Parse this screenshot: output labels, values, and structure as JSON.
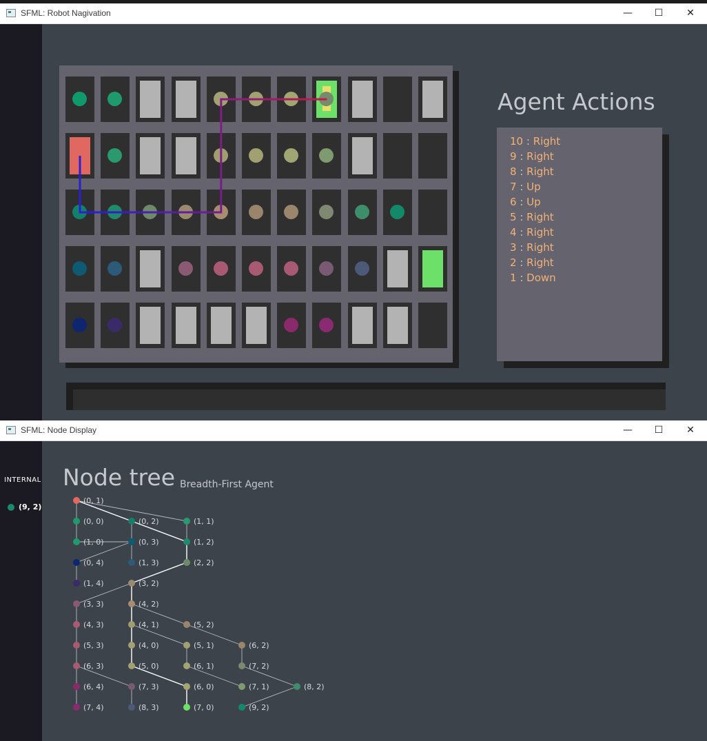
{
  "window1": {
    "title": "SFML: Robot Nagivation",
    "controls": {
      "minimize": "—",
      "maximize": "☐",
      "close": "✕"
    }
  },
  "window2": {
    "title": "SFML: Node Display",
    "controls": {
      "minimize": "—",
      "maximize": "☐",
      "close": "✕"
    }
  },
  "grid": {
    "cols": 11,
    "rows": 5,
    "cells": [
      [
        "#0f9a6b",
        "#1f9a6c",
        "wall",
        "wall",
        "#a3a074",
        "#a0a070",
        "#a2a671",
        "goal-current",
        "wall",
        "empty",
        "wall"
      ],
      [
        "start",
        "#2a9a6e",
        "wall",
        "wall",
        "#a09d70",
        "#a0a070",
        "#9fa672",
        "#7e9a6e",
        "wall",
        "empty",
        "empty"
      ],
      [
        "#15806a",
        "#1f8a6c",
        "#6f8a6a",
        "#9a8a6e",
        "#a88c70",
        "#9a846c",
        "#9a866c",
        "#7f8870",
        "#3e8e6c",
        "#128a6a",
        "empty"
      ],
      [
        "#0d5a72",
        "#2e5a7a",
        "wall",
        "#8a5a72",
        "#a85a72",
        "#a85a72",
        "#a85a74",
        "#7a5a72",
        "#4c5a7a",
        "wall",
        "goal"
      ],
      [
        "#0e2670",
        "#3a2a6a",
        "wall",
        "wall",
        "wall",
        "wall",
        "#8a2a6a",
        "#8a2a72",
        "wall",
        "wall",
        "empty"
      ]
    ],
    "colors": {
      "start": "#e06860",
      "goal": "#6de06a",
      "current_marker": "#e8e06a",
      "current_dot": "#788a6c",
      "path_start": "#2a1fd0",
      "path_end": "#c21a4a"
    },
    "path_cells": [
      [
        0,
        1
      ],
      [
        0,
        2
      ],
      [
        1,
        2
      ],
      [
        2,
        2
      ],
      [
        3,
        2
      ],
      [
        4,
        2
      ],
      [
        4,
        1
      ],
      [
        4,
        0
      ],
      [
        5,
        0
      ],
      [
        6,
        0
      ],
      [
        7,
        0
      ]
    ]
  },
  "actions": {
    "title": "Agent Actions",
    "items": [
      {
        "num": "10",
        "dir": "Right"
      },
      {
        "num": "9",
        "dir": "Right"
      },
      {
        "num": "8",
        "dir": "Right"
      },
      {
        "num": "7",
        "dir": "Up"
      },
      {
        "num": "6",
        "dir": "Up"
      },
      {
        "num": "5",
        "dir": "Right"
      },
      {
        "num": "4",
        "dir": "Right"
      },
      {
        "num": "3",
        "dir": "Right"
      },
      {
        "num": "2",
        "dir": "Right"
      },
      {
        "num": "1",
        "dir": "Down"
      }
    ]
  },
  "node_display": {
    "internal_label": "INTERNAL",
    "internal_node": "(9, 2)",
    "internal_color": "#1b8a6b",
    "tree_title": "Node tree",
    "tree_subtitle": "Breadth-First Agent",
    "nodes": [
      {
        "id": "0,1",
        "label": "(0, 1)",
        "color": "#e06860",
        "col": 0,
        "row": 0
      },
      {
        "id": "0,0",
        "label": "(0, 0)",
        "color": "#1f9a6c",
        "col": 0,
        "row": 1
      },
      {
        "id": "0,2",
        "label": "(0, 2)",
        "color": "#15806a",
        "col": 1,
        "row": 1
      },
      {
        "id": "1,1",
        "label": "(1, 1)",
        "color": "#2a9a6e",
        "col": 2,
        "row": 1
      },
      {
        "id": "1,0",
        "label": "(1, 0)",
        "color": "#1f9a6c",
        "col": 0,
        "row": 2
      },
      {
        "id": "0,3",
        "label": "(0, 3)",
        "color": "#0d5a72",
        "col": 1,
        "row": 2
      },
      {
        "id": "1,2",
        "label": "(1, 2)",
        "color": "#1f8a6c",
        "col": 2,
        "row": 2
      },
      {
        "id": "0,4",
        "label": "(0, 4)",
        "color": "#0e2670",
        "col": 0,
        "row": 3
      },
      {
        "id": "1,3",
        "label": "(1, 3)",
        "color": "#2e5a7a",
        "col": 1,
        "row": 3
      },
      {
        "id": "2,2",
        "label": "(2, 2)",
        "color": "#6f8a6a",
        "col": 2,
        "row": 3
      },
      {
        "id": "1,4",
        "label": "(1, 4)",
        "color": "#3a2a6a",
        "col": 0,
        "row": 4
      },
      {
        "id": "3,2",
        "label": "(3, 2)",
        "color": "#9a8a6e",
        "col": 1,
        "row": 4
      },
      {
        "id": "3,3",
        "label": "(3, 3)",
        "color": "#8a5a72",
        "col": 0,
        "row": 5
      },
      {
        "id": "4,2",
        "label": "(4, 2)",
        "color": "#a88c70",
        "col": 1,
        "row": 5
      },
      {
        "id": "4,3",
        "label": "(4, 3)",
        "color": "#a85a72",
        "col": 0,
        "row": 6
      },
      {
        "id": "4,1",
        "label": "(4, 1)",
        "color": "#a09d70",
        "col": 1,
        "row": 6
      },
      {
        "id": "5,2",
        "label": "(5, 2)",
        "color": "#9a846c",
        "col": 2,
        "row": 6
      },
      {
        "id": "5,3",
        "label": "(5, 3)",
        "color": "#a85a72",
        "col": 0,
        "row": 7
      },
      {
        "id": "4,0",
        "label": "(4, 0)",
        "color": "#a3a074",
        "col": 1,
        "row": 7
      },
      {
        "id": "5,1",
        "label": "(5, 1)",
        "color": "#a0a070",
        "col": 2,
        "row": 7
      },
      {
        "id": "6,2",
        "label": "(6, 2)",
        "color": "#9a866c",
        "col": 3,
        "row": 7
      },
      {
        "id": "6,3",
        "label": "(6, 3)",
        "color": "#a85a74",
        "col": 0,
        "row": 8
      },
      {
        "id": "5,0",
        "label": "(5, 0)",
        "color": "#a0a070",
        "col": 1,
        "row": 8
      },
      {
        "id": "6,1",
        "label": "(6, 1)",
        "color": "#9fa672",
        "col": 2,
        "row": 8
      },
      {
        "id": "7,2",
        "label": "(7, 2)",
        "color": "#7f8870",
        "col": 3,
        "row": 8
      },
      {
        "id": "6,4",
        "label": "(6, 4)",
        "color": "#8a2a6a",
        "col": 0,
        "row": 9
      },
      {
        "id": "7,3",
        "label": "(7, 3)",
        "color": "#7a5a72",
        "col": 1,
        "row": 9
      },
      {
        "id": "6,0",
        "label": "(6, 0)",
        "color": "#a2a671",
        "col": 2,
        "row": 9
      },
      {
        "id": "7,1",
        "label": "(7, 1)",
        "color": "#7e9a6e",
        "col": 3,
        "row": 9
      },
      {
        "id": "8,2",
        "label": "(8, 2)",
        "color": "#3e8e6c",
        "col": 4,
        "row": 9
      },
      {
        "id": "7,4",
        "label": "(7, 4)",
        "color": "#8a2a72",
        "col": 0,
        "row": 10
      },
      {
        "id": "8,3",
        "label": "(8, 3)",
        "color": "#4c5a7a",
        "col": 1,
        "row": 10
      },
      {
        "id": "7,0",
        "label": "(7, 0)",
        "color": "#6de06a",
        "col": 2,
        "row": 10
      },
      {
        "id": "9,2",
        "label": "(9, 2)",
        "color": "#128a6a",
        "col": 3,
        "row": 10
      }
    ],
    "edges": [
      {
        "from": "0,1",
        "to": "0,0",
        "solution": false
      },
      {
        "from": "0,1",
        "to": "0,2",
        "solution": true
      },
      {
        "from": "0,1",
        "to": "1,1",
        "solution": false
      },
      {
        "from": "0,0",
        "to": "1,0",
        "solution": false
      },
      {
        "from": "0,2",
        "to": "0,3",
        "solution": false
      },
      {
        "from": "0,2",
        "to": "1,2",
        "solution": true
      },
      {
        "from": "1,0",
        "to": "0,3",
        "solution": false
      },
      {
        "from": "1,1",
        "to": "1,2",
        "solution": false
      },
      {
        "from": "0,3",
        "to": "0,4",
        "solution": false
      },
      {
        "from": "0,3",
        "to": "1,3",
        "solution": false
      },
      {
        "from": "1,2",
        "to": "2,2",
        "solution": true
      },
      {
        "from": "0,4",
        "to": "1,4",
        "solution": false
      },
      {
        "from": "2,2",
        "to": "3,2",
        "solution": true
      },
      {
        "from": "3,2",
        "to": "3,3",
        "solution": false
      },
      {
        "from": "3,2",
        "to": "4,2",
        "solution": true
      },
      {
        "from": "3,3",
        "to": "4,3",
        "solution": false
      },
      {
        "from": "4,2",
        "to": "4,1",
        "solution": true
      },
      {
        "from": "4,2",
        "to": "5,2",
        "solution": false
      },
      {
        "from": "4,3",
        "to": "5,3",
        "solution": false
      },
      {
        "from": "4,1",
        "to": "4,0",
        "solution": true
      },
      {
        "from": "4,1",
        "to": "5,1",
        "solution": false
      },
      {
        "from": "5,2",
        "to": "6,2",
        "solution": false
      },
      {
        "from": "5,3",
        "to": "6,3",
        "solution": false
      },
      {
        "from": "4,0",
        "to": "5,0",
        "solution": true
      },
      {
        "from": "5,1",
        "to": "6,1",
        "solution": false
      },
      {
        "from": "6,2",
        "to": "7,2",
        "solution": false
      },
      {
        "from": "6,3",
        "to": "6,4",
        "solution": false
      },
      {
        "from": "6,3",
        "to": "7,3",
        "solution": false
      },
      {
        "from": "5,0",
        "to": "6,0",
        "solution": true
      },
      {
        "from": "6,1",
        "to": "7,1",
        "solution": false
      },
      {
        "from": "7,2",
        "to": "8,2",
        "solution": false
      },
      {
        "from": "6,4",
        "to": "7,4",
        "solution": false
      },
      {
        "from": "7,3",
        "to": "8,3",
        "solution": false
      },
      {
        "from": "6,0",
        "to": "7,0",
        "solution": true
      },
      {
        "from": "8,2",
        "to": "9,2",
        "solution": false
      }
    ]
  }
}
